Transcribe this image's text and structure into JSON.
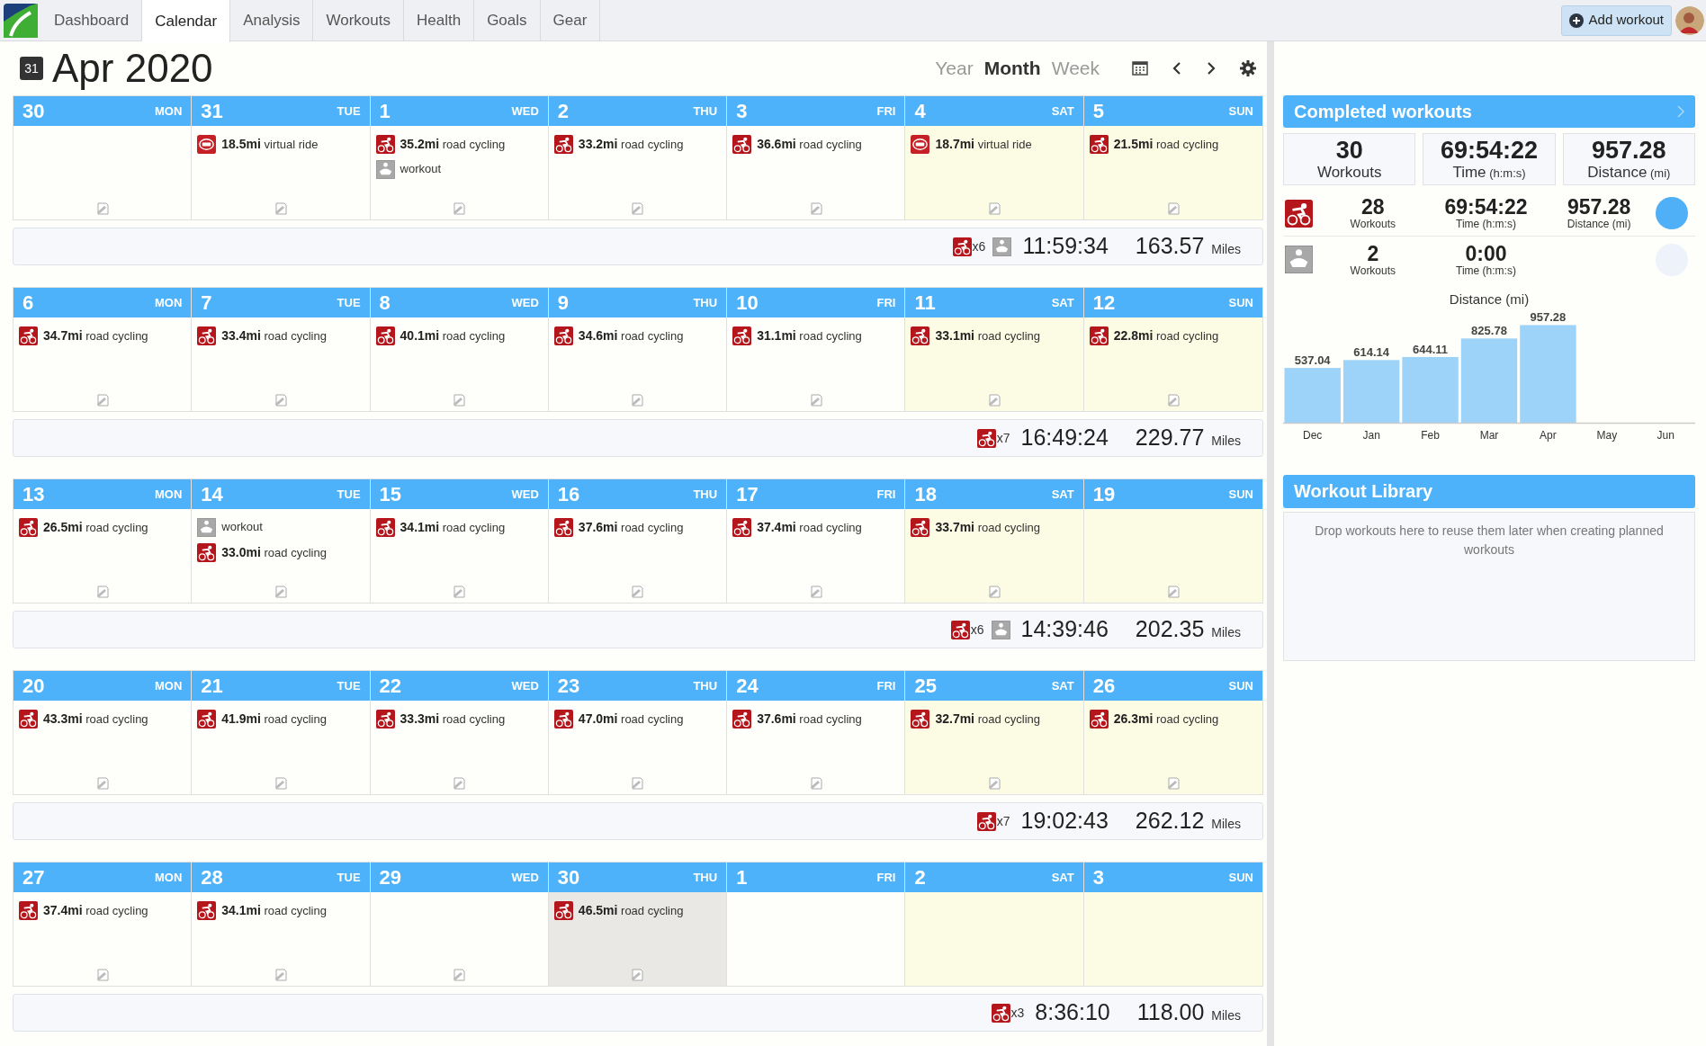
{
  "nav": {
    "tabs": [
      {
        "label": "Dashboard",
        "selected": false
      },
      {
        "label": "Calendar",
        "selected": true
      },
      {
        "label": "Analysis",
        "selected": false
      },
      {
        "label": "Workouts",
        "selected": false
      },
      {
        "label": "Health",
        "selected": false
      },
      {
        "label": "Goals",
        "selected": false
      },
      {
        "label": "Gear",
        "selected": false
      }
    ],
    "add_button": "Add workout"
  },
  "header": {
    "calendar_icon_text": "31",
    "title": "Apr 2020",
    "views": [
      {
        "label": "Year",
        "selected": false
      },
      {
        "label": "Month",
        "selected": true
      },
      {
        "label": "Week",
        "selected": false
      }
    ]
  },
  "weeks": [
    {
      "days": [
        {
          "date": "30",
          "dow": "MON",
          "weekend": false,
          "today": false,
          "add_icon": true
        },
        {
          "date": "31",
          "dow": "TUE",
          "weekend": false,
          "today": false,
          "add_icon": true,
          "workouts": [
            {
              "kind": "virtual",
              "distance": "18.5mi",
              "label": "virtual ride"
            }
          ]
        },
        {
          "date": "1",
          "dow": "WED",
          "weekend": false,
          "today": false,
          "add_icon": true,
          "workouts": [
            {
              "kind": "road",
              "distance": "35.2mi",
              "label": "road cycling"
            },
            {
              "kind": "workout",
              "label": "workout"
            }
          ]
        },
        {
          "date": "2",
          "dow": "THU",
          "weekend": false,
          "today": false,
          "add_icon": true,
          "workouts": [
            {
              "kind": "road",
              "distance": "33.2mi",
              "label": "road cycling"
            }
          ]
        },
        {
          "date": "3",
          "dow": "FRI",
          "weekend": false,
          "today": false,
          "add_icon": true,
          "workouts": [
            {
              "kind": "road",
              "distance": "36.6mi",
              "label": "road cycling"
            }
          ]
        },
        {
          "date": "4",
          "dow": "SAT",
          "weekend": true,
          "today": false,
          "add_icon": true,
          "workouts": [
            {
              "kind": "virtual",
              "distance": "18.7mi",
              "label": "virtual ride"
            }
          ]
        },
        {
          "date": "5",
          "dow": "SUN",
          "weekend": true,
          "today": false,
          "add_icon": true,
          "workouts": [
            {
              "kind": "road",
              "distance": "21.5mi",
              "label": "road cycling"
            }
          ]
        }
      ],
      "summary": {
        "types": [
          {
            "kind": "road",
            "count": "x6"
          },
          {
            "kind": "workout"
          }
        ],
        "time": "11:59:34",
        "distance": "163.57",
        "unit": "Miles"
      }
    },
    {
      "days": [
        {
          "date": "6",
          "dow": "MON",
          "weekend": false,
          "today": false,
          "add_icon": true,
          "workouts": [
            {
              "kind": "road",
              "distance": "34.7mi",
              "label": "road cycling"
            }
          ]
        },
        {
          "date": "7",
          "dow": "TUE",
          "weekend": false,
          "today": false,
          "add_icon": true,
          "workouts": [
            {
              "kind": "road",
              "distance": "33.4mi",
              "label": "road cycling"
            }
          ]
        },
        {
          "date": "8",
          "dow": "WED",
          "weekend": false,
          "today": false,
          "add_icon": true,
          "workouts": [
            {
              "kind": "road",
              "distance": "40.1mi",
              "label": "road cycling"
            }
          ]
        },
        {
          "date": "9",
          "dow": "THU",
          "weekend": false,
          "today": false,
          "add_icon": true,
          "workouts": [
            {
              "kind": "road",
              "distance": "34.6mi",
              "label": "road cycling"
            }
          ]
        },
        {
          "date": "10",
          "dow": "FRI",
          "weekend": false,
          "today": false,
          "add_icon": true,
          "workouts": [
            {
              "kind": "road",
              "distance": "31.1mi",
              "label": "road cycling"
            }
          ]
        },
        {
          "date": "11",
          "dow": "SAT",
          "weekend": true,
          "today": false,
          "add_icon": true,
          "workouts": [
            {
              "kind": "road",
              "distance": "33.1mi",
              "label": "road cycling"
            }
          ]
        },
        {
          "date": "12",
          "dow": "SUN",
          "weekend": true,
          "today": false,
          "add_icon": true,
          "workouts": [
            {
              "kind": "road",
              "distance": "22.8mi",
              "label": "road cycling"
            }
          ]
        }
      ],
      "summary": {
        "types": [
          {
            "kind": "road",
            "count": "x7"
          }
        ],
        "time": "16:49:24",
        "distance": "229.77",
        "unit": "Miles"
      }
    },
    {
      "days": [
        {
          "date": "13",
          "dow": "MON",
          "weekend": false,
          "today": false,
          "add_icon": true,
          "workouts": [
            {
              "kind": "road",
              "distance": "26.5mi",
              "label": "road cycling"
            }
          ]
        },
        {
          "date": "14",
          "dow": "TUE",
          "weekend": false,
          "today": false,
          "add_icon": true,
          "workouts": [
            {
              "kind": "workout",
              "label": "workout"
            },
            {
              "kind": "road",
              "distance": "33.0mi",
              "label": "road cycling"
            }
          ]
        },
        {
          "date": "15",
          "dow": "WED",
          "weekend": false,
          "today": false,
          "add_icon": true,
          "workouts": [
            {
              "kind": "road",
              "distance": "34.1mi",
              "label": "road cycling"
            }
          ]
        },
        {
          "date": "16",
          "dow": "THU",
          "weekend": false,
          "today": false,
          "add_icon": true,
          "workouts": [
            {
              "kind": "road",
              "distance": "37.6mi",
              "label": "road cycling"
            }
          ]
        },
        {
          "date": "17",
          "dow": "FRI",
          "weekend": false,
          "today": false,
          "add_icon": true,
          "workouts": [
            {
              "kind": "road",
              "distance": "37.4mi",
              "label": "road cycling"
            }
          ]
        },
        {
          "date": "18",
          "dow": "SAT",
          "weekend": true,
          "today": false,
          "add_icon": true,
          "workouts": [
            {
              "kind": "road",
              "distance": "33.7mi",
              "label": "road cycling"
            }
          ]
        },
        {
          "date": "19",
          "dow": "SUN",
          "weekend": true,
          "today": false,
          "add_icon": true
        }
      ],
      "summary": {
        "types": [
          {
            "kind": "road",
            "count": "x6"
          },
          {
            "kind": "workout"
          }
        ],
        "time": "14:39:46",
        "distance": "202.35",
        "unit": "Miles"
      }
    },
    {
      "days": [
        {
          "date": "20",
          "dow": "MON",
          "weekend": false,
          "today": false,
          "add_icon": true,
          "workouts": [
            {
              "kind": "road",
              "distance": "43.3mi",
              "label": "road cycling"
            }
          ]
        },
        {
          "date": "21",
          "dow": "TUE",
          "weekend": false,
          "today": false,
          "add_icon": true,
          "workouts": [
            {
              "kind": "road",
              "distance": "41.9mi",
              "label": "road cycling"
            }
          ]
        },
        {
          "date": "22",
          "dow": "WED",
          "weekend": false,
          "today": false,
          "add_icon": true,
          "workouts": [
            {
              "kind": "road",
              "distance": "33.3mi",
              "label": "road cycling"
            }
          ]
        },
        {
          "date": "23",
          "dow": "THU",
          "weekend": false,
          "today": false,
          "add_icon": true,
          "workouts": [
            {
              "kind": "road",
              "distance": "47.0mi",
              "label": "road cycling"
            }
          ]
        },
        {
          "date": "24",
          "dow": "FRI",
          "weekend": false,
          "today": false,
          "add_icon": true,
          "workouts": [
            {
              "kind": "road",
              "distance": "37.6mi",
              "label": "road cycling"
            }
          ]
        },
        {
          "date": "25",
          "dow": "SAT",
          "weekend": true,
          "today": false,
          "add_icon": true,
          "workouts": [
            {
              "kind": "road",
              "distance": "32.7mi",
              "label": "road cycling"
            }
          ]
        },
        {
          "date": "26",
          "dow": "SUN",
          "weekend": true,
          "today": false,
          "add_icon": true,
          "workouts": [
            {
              "kind": "road",
              "distance": "26.3mi",
              "label": "road cycling"
            }
          ]
        }
      ],
      "summary": {
        "types": [
          {
            "kind": "road",
            "count": "x7"
          }
        ],
        "time": "19:02:43",
        "distance": "262.12",
        "unit": "Miles"
      }
    },
    {
      "days": [
        {
          "date": "27",
          "dow": "MON",
          "weekend": false,
          "today": false,
          "add_icon": true,
          "workouts": [
            {
              "kind": "road",
              "distance": "37.4mi",
              "label": "road cycling"
            }
          ]
        },
        {
          "date": "28",
          "dow": "TUE",
          "weekend": false,
          "today": false,
          "add_icon": true,
          "workouts": [
            {
              "kind": "road",
              "distance": "34.1mi",
              "label": "road cycling"
            }
          ]
        },
        {
          "date": "29",
          "dow": "WED",
          "weekend": false,
          "today": false,
          "add_icon": true
        },
        {
          "date": "30",
          "dow": "THU",
          "weekend": false,
          "today": true,
          "add_icon": true,
          "workouts": [
            {
              "kind": "road",
              "distance": "46.5mi",
              "label": "road cycling"
            }
          ]
        },
        {
          "date": "1",
          "dow": "FRI",
          "weekend": false,
          "today": false,
          "add_icon": false
        },
        {
          "date": "2",
          "dow": "SAT",
          "weekend": true,
          "today": false,
          "add_icon": false
        },
        {
          "date": "3",
          "dow": "SUN",
          "weekend": true,
          "today": false,
          "add_icon": false
        }
      ],
      "summary": {
        "types": [
          {
            "kind": "road",
            "count": "x3"
          }
        ],
        "time": "8:36:10",
        "distance": "118.00",
        "unit": "Miles"
      }
    }
  ],
  "completed": {
    "title": "Completed workouts",
    "totals": [
      {
        "value": "30",
        "label": "Workouts"
      },
      {
        "value": "69:54:22",
        "label": "Time",
        "unit": "(h:m:s)"
      },
      {
        "value": "957.28",
        "label": "Distance",
        "unit": "(mi)"
      }
    ],
    "types": [
      {
        "kind": "road",
        "color": "#4fb0f7",
        "stats": [
          {
            "value": "28",
            "label": "Workouts"
          },
          {
            "value": "69:54:22",
            "label": "Time (h:m:s)"
          },
          {
            "value": "957.28",
            "label": "Distance (mi)"
          }
        ]
      },
      {
        "kind": "workout",
        "color": "#eef2fb",
        "stats": [
          {
            "value": "2",
            "label": "Workouts"
          },
          {
            "value": "0:00",
            "label": "Time (h:m:s)"
          }
        ]
      }
    ],
    "chart_data": {
      "type": "bar",
      "title": "Distance (mi)",
      "categories": [
        "Dec",
        "Jan",
        "Feb",
        "Mar",
        "Apr",
        "May",
        "Jun"
      ],
      "series": [
        {
          "color": "#9dd3f8",
          "values": [
            537.04,
            614.14,
            644.11,
            825.78,
            957.28,
            null,
            null
          ]
        }
      ],
      "data_labels": true
    }
  },
  "library": {
    "title": "Workout Library",
    "message": "Drop workouts here to reuse them later when creating planned workouts"
  }
}
